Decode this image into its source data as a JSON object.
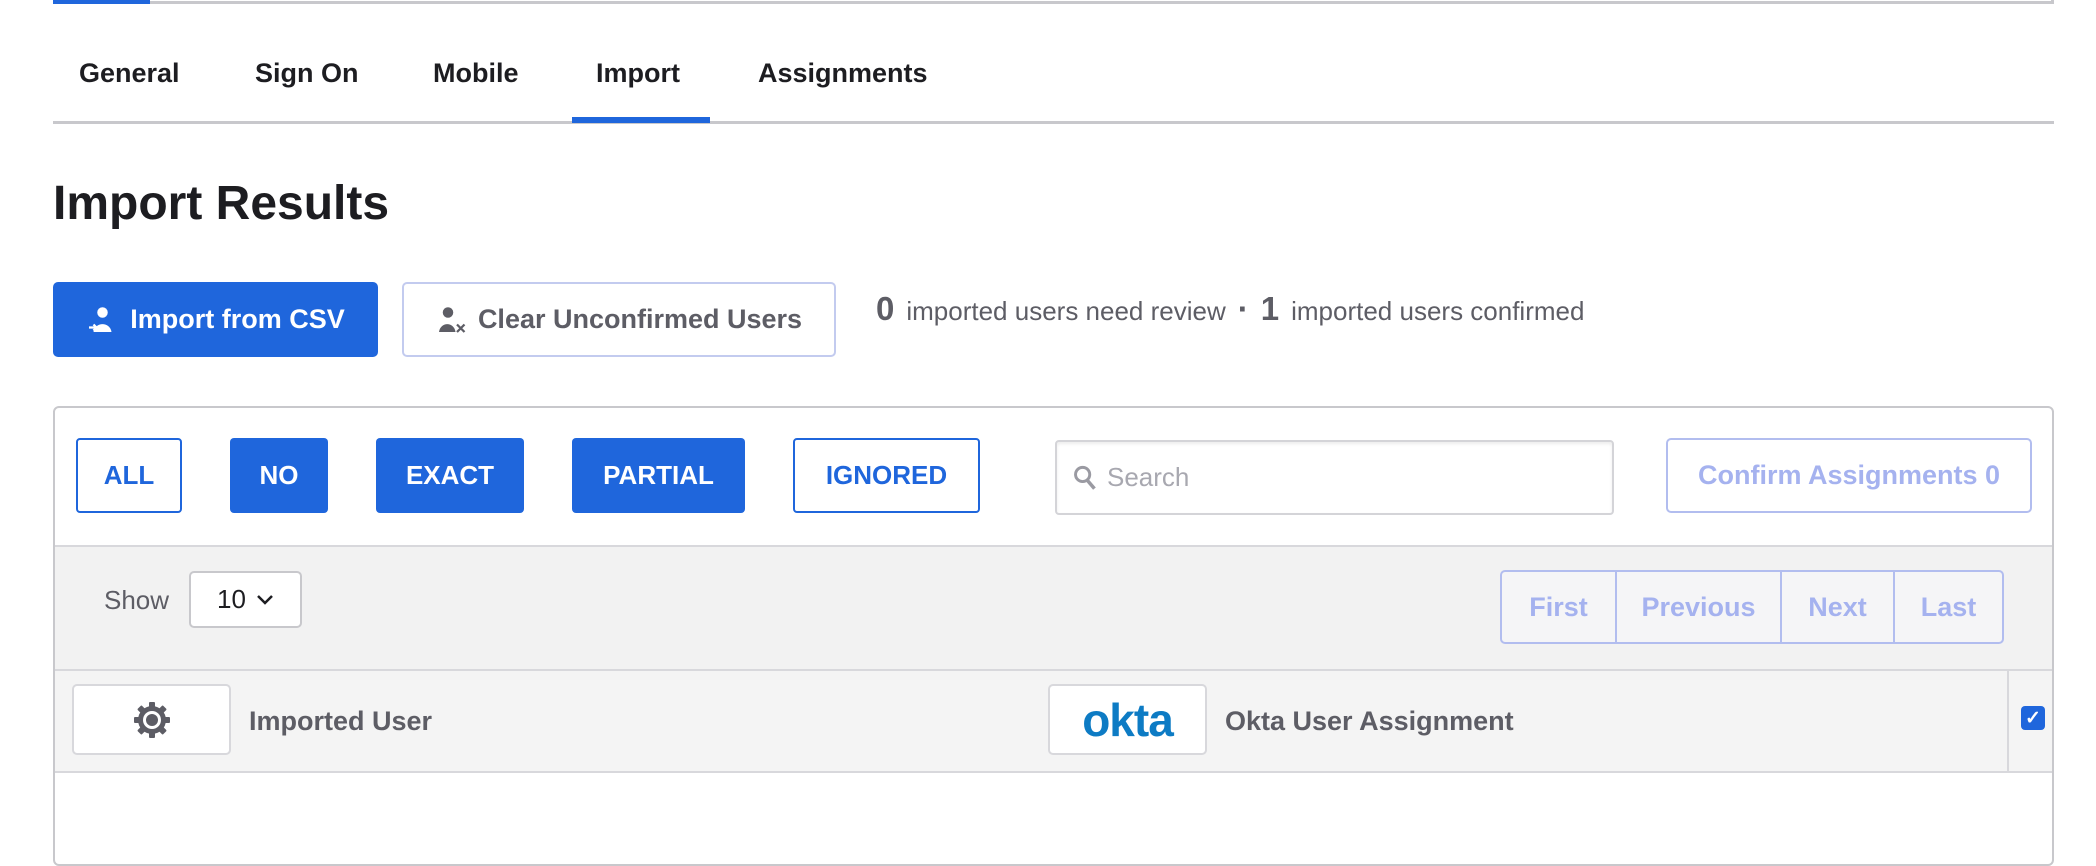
{
  "tabs": [
    {
      "label": "General"
    },
    {
      "label": "Sign On"
    },
    {
      "label": "Mobile"
    },
    {
      "label": "Import",
      "active": true
    },
    {
      "label": "Assignments"
    }
  ],
  "page_title": "Import Results",
  "actions": {
    "import_csv": "Import from CSV",
    "clear_unconfirmed": "Clear Unconfirmed Users"
  },
  "stats": {
    "review_count": "0",
    "review_label": "imported users need review",
    "separator": "·",
    "confirmed_count": "1",
    "confirmed_label": "imported users confirmed"
  },
  "filters": [
    {
      "label": "ALL",
      "selected": false
    },
    {
      "label": "NO",
      "selected": true
    },
    {
      "label": "EXACT",
      "selected": true
    },
    {
      "label": "PARTIAL",
      "selected": true
    },
    {
      "label": "IGNORED",
      "selected": false
    }
  ],
  "search": {
    "placeholder": "Search",
    "value": ""
  },
  "confirm_button": "Confirm Assignments 0",
  "show": {
    "label": "Show",
    "value": "10"
  },
  "pagination": [
    "First",
    "Previous",
    "Next",
    "Last"
  ],
  "columns": {
    "imported_user": "Imported User",
    "okta_assignment": "Okta User Assignment",
    "logo_text": "okta",
    "select_all_checked": true
  },
  "colors": {
    "accent": "#1f66dc",
    "okta_logo": "#0d7bc4"
  }
}
